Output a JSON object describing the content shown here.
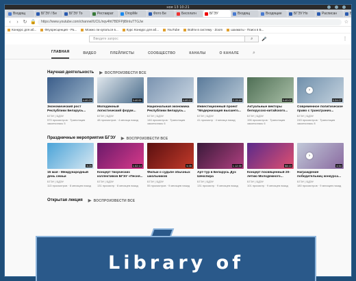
{
  "os": {
    "time": "ноя 13 10:21"
  },
  "tabs": [
    {
      "label": "Входящ",
      "color": "#4a7bd0"
    },
    {
      "label": "БГЭУ / Бе",
      "color": "#2a5bb0"
    },
    {
      "label": "БГЭУ То",
      "color": "#2a5bb0"
    },
    {
      "label": "Реставрат",
      "color": "#3a7a3a"
    },
    {
      "label": "DropMe",
      "color": "#1a8af0"
    },
    {
      "label": "Фото Бе",
      "color": "#2a5bb0"
    },
    {
      "label": "Бесплатн",
      "color": "#e33"
    },
    {
      "label": "БГЭУ",
      "color": "#e00",
      "active": true
    },
    {
      "label": "Входящ",
      "color": "#4a7bd0"
    },
    {
      "label": "Входящие",
      "color": "#4a7bd0"
    },
    {
      "label": "БГЭУ Но",
      "color": "#2a5bb0"
    },
    {
      "label": "Расписан",
      "color": "#2a5bb0"
    },
    {
      "label": "Вторичн",
      "color": "#2a5bb0"
    }
  ],
  "address": {
    "url": "https://www.youtube.com/channel/UCIL/nqv4ht7BDFPjl8/nIuTTGJw"
  },
  "bookmarks": [
    "Конкурс для аб...",
    "Флуоресценция - Ра...",
    "Можно ли купаться в...",
    "Курс Конкурс для аб...",
    "YouTube",
    "Войти в систему · Zoom",
    "шахматы - Поиск в Б..."
  ],
  "search": {
    "placeholder": "Введите запрос"
  },
  "channel_tabs": [
    "ГЛАВНАЯ",
    "ВИДЕО",
    "ПЛЕЙЛИСТЫ",
    "СООБЩЕСТВО",
    "КАНАЛЫ",
    "О КАНАЛЕ"
  ],
  "play_all": "ВОСПРОИЗВЕСТИ ВСЕ",
  "sections": [
    {
      "title": "Научная деятельность",
      "videos": [
        {
          "title": "Экономический рост Республики Беларусь...",
          "channel": "БГЭУ | БДЭУ",
          "meta": "570 просмотров · Трансляция закончилась 5",
          "duration": "4:40:23",
          "c1": "#3b5d8a",
          "c2": "#9bb4c9"
        },
        {
          "title": "Молодежный логистический форум...",
          "channel": "БГЭУ | БДЭУ",
          "meta": "48 просмотров · 4 месяца назад",
          "duration": "3:40:51",
          "c1": "#dfe6ec",
          "c2": "#4b6d8c"
        },
        {
          "title": "Национальная экономика Республики Беларусь...",
          "channel": "БГЭУ | БДЭУ",
          "meta": "146 просмотров · Трансляция закончилась 6",
          "duration": "4:40:12",
          "c1": "#7a93b0",
          "c2": "#c9d6e2"
        },
        {
          "title": "Инвестиционный проект \"Модернизация высшего...",
          "channel": "БГЭУ | БДЭУ",
          "meta": "41 просмотр · 4 месяца назад",
          "duration": "2:15:44",
          "c1": "#5a7a9a",
          "c2": "#b7c8d6"
        },
        {
          "title": "Актуальные векторы белорусско-китайского...",
          "channel": "БГЭУ | БДЭУ",
          "meta": "196 просмотров · Трансляция закончилась 6",
          "duration": "5:40:02",
          "c1": "#4f6f55",
          "c2": "#a9bfa7"
        },
        {
          "title": "Современное политическое право с трансгранич...",
          "channel": "БГЭУ | БДЭУ",
          "meta": "245 просмотров · Трансляция закончилась 8",
          "duration": "5:34:07",
          "c1": "#6f8fab",
          "c2": "#c5d3df"
        }
      ]
    },
    {
      "title": "Праздничные мероприятия БГЭУ",
      "videos": [
        {
          "title": "15 мая - Международный день семьи",
          "channel": "БГЭУ | БДЭУ",
          "meta": "113 просмотров · 8 месяцев назад",
          "duration": "3:25",
          "c1": "#4aa3d8",
          "c2": "#d8e8f2"
        },
        {
          "title": "Концерт творческих коллективов БГЭУ «Песня...",
          "channel": "БГЭУ | БДЭУ",
          "meta": "131 просмотр · 8 месяцев назад",
          "duration": "1:02:14",
          "c1": "#6a1a6a",
          "c2": "#d83a8a"
        },
        {
          "title": "Фильм о судьбе обычных школьников",
          "channel": "БГЭУ | БДЭУ",
          "meta": "55 просмотров · 9 месяцев назад",
          "duration": "5:35",
          "c1": "#5a1010",
          "c2": "#c43a2a"
        },
        {
          "title": "Арт-тур в Беларусь Дух Шекспира",
          "channel": "БГЭУ | БДЭУ",
          "meta": "131 просмотр · 9 месяцев назад",
          "duration": "1:12:30",
          "c1": "#3a1a3a",
          "c2": "#b04080"
        },
        {
          "title": "Концерт посвященный 20-летию Молодежного...",
          "channel": "БГЭУ | БДЭУ",
          "meta": "101 просмотр · 9 месяцев назад",
          "duration": "58:10",
          "c1": "#5a2a8a",
          "c2": "#e05070"
        },
        {
          "title": "Награждение победительниц конкурса...",
          "channel": "БГЭУ | БДЭУ",
          "meta": "180 просмотров · 9 месяцев назад",
          "duration": "4:54",
          "c1": "#c0c8d8",
          "c2": "#8a6aa0"
        }
      ]
    },
    {
      "title": "Открытая лекция",
      "videos": []
    }
  ],
  "banner": {
    "text": "Library of"
  }
}
